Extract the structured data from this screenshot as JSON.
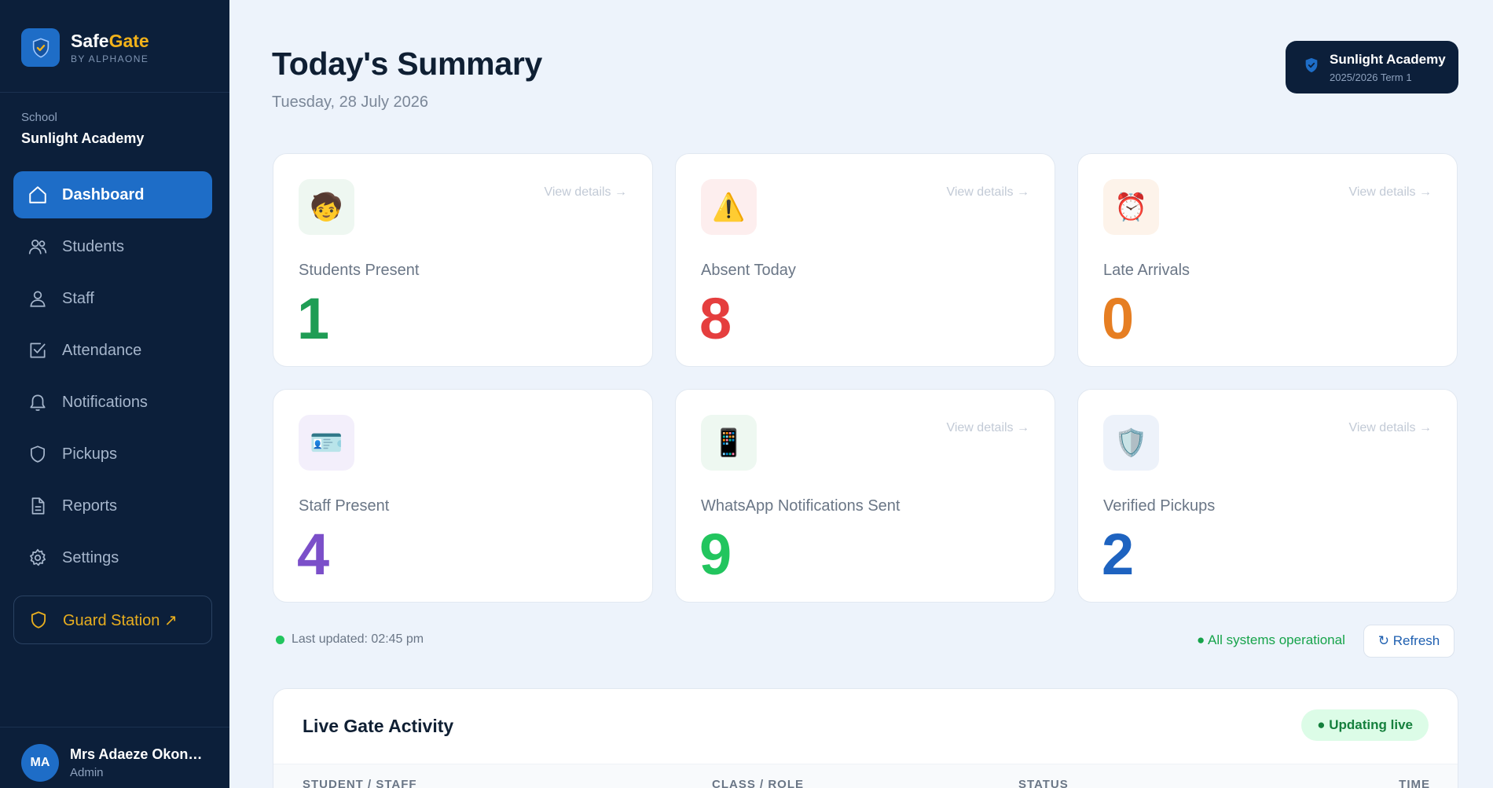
{
  "brand": {
    "name_part1": "Safe",
    "name_part2": "Gate",
    "subtitle": "BY ALPHAONE"
  },
  "school": {
    "label": "School",
    "name": "Sunlight Academy"
  },
  "nav": [
    {
      "label": "Dashboard",
      "icon": "home-icon",
      "active": true
    },
    {
      "label": "Students",
      "icon": "users-icon"
    },
    {
      "label": "Staff",
      "icon": "user-icon"
    },
    {
      "label": "Attendance",
      "icon": "check-square-icon"
    },
    {
      "label": "Notifications",
      "icon": "bell-icon"
    },
    {
      "label": "Pickups",
      "icon": "shield-icon"
    },
    {
      "label": "Reports",
      "icon": "document-icon"
    },
    {
      "label": "Settings",
      "icon": "gear-icon"
    }
  ],
  "guard_station": {
    "label": "Guard Station ↗",
    "icon": "shield-icon"
  },
  "user": {
    "initials": "MA",
    "name": "Mrs Adaeze Okonkwo",
    "role": "Admin"
  },
  "header": {
    "title": "Today's Summary",
    "date": "Tuesday, 28 July 2026"
  },
  "school_chip": {
    "name": "Sunlight Academy",
    "term": "2025/2026 Term 1"
  },
  "cards": [
    {
      "label": "Students Present",
      "value": "1",
      "link": "View details →",
      "icon": "student-face-icon",
      "glyph": "🧒",
      "color": "#1f9d55",
      "icon_bg": "#eef7f1"
    },
    {
      "label": "Absent Today",
      "value": "8",
      "link": "View details →",
      "icon": "warning-icon",
      "glyph": "⚠️",
      "color": "#e53e3e",
      "icon_bg": "#fdeeee"
    },
    {
      "label": "Late Arrivals",
      "value": "0",
      "link": "View details →",
      "icon": "alarm-clock-icon",
      "glyph": "⏰",
      "color": "#e67e22",
      "icon_bg": "#fdf3ea"
    },
    {
      "label": "Staff Present",
      "value": "4",
      "link": "",
      "icon": "id-card-icon",
      "glyph": "🪪",
      "color": "#7b4fc9",
      "icon_bg": "#f3effb"
    },
    {
      "label": "WhatsApp Notifications Sent",
      "value": "9",
      "link": "View details →",
      "icon": "phone-icon",
      "glyph": "📱",
      "color": "#22c55e",
      "icon_bg": "#eef8f1"
    },
    {
      "label": "Verified Pickups",
      "value": "2",
      "link": "View details →",
      "icon": "shield-icon",
      "glyph": "🛡️",
      "color": "#1e63c0",
      "icon_bg": "#edf2fa"
    }
  ],
  "status": {
    "last_updated": "Last updated: 02:45 pm",
    "systems": "● All systems operational",
    "refresh_label": "↻ Refresh"
  },
  "live": {
    "title": "Live Gate Activity",
    "badge": "● Updating live",
    "columns": [
      "STUDENT / STAFF",
      "CLASS / ROLE",
      "STATUS",
      "TIME"
    ]
  },
  "colors": {
    "sidebar": "#0c1f3a",
    "accent": "#1e6dc7",
    "gold": "#f2b21a",
    "background": "#edf3fb"
  }
}
